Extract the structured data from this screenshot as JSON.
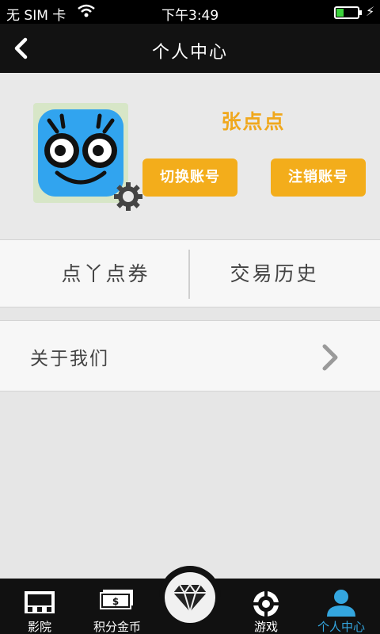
{
  "status_bar": {
    "carrier": "无 SIM 卡",
    "time": "下午3:49",
    "icons": [
      "wifi-icon",
      "battery-icon",
      "charging-icon"
    ]
  },
  "header": {
    "title": "个人中心",
    "back_icon": "chevron-left-icon"
  },
  "profile": {
    "name": "张点点",
    "avatar_icon": "robot-avatar",
    "settings_icon": "gear-icon",
    "switch_account_label": "切换账号",
    "logout_label": "注销账号",
    "accent_color": "#f3ad1b"
  },
  "tabs": [
    {
      "label": "点丫点券"
    },
    {
      "label": "交易历史"
    }
  ],
  "about": {
    "label": "关于我们",
    "icon": "chevron-right-icon"
  },
  "bottom_nav": {
    "items": [
      {
        "label": "影院",
        "icon": "cinema-icon"
      },
      {
        "label": "积分金币",
        "icon": "money-icon"
      },
      {
        "label": "",
        "icon": "diamond-icon"
      },
      {
        "label": "游戏",
        "icon": "crosshair-icon"
      },
      {
        "label": "个人中心",
        "icon": "user-icon"
      }
    ],
    "active_color": "#34a6df"
  }
}
